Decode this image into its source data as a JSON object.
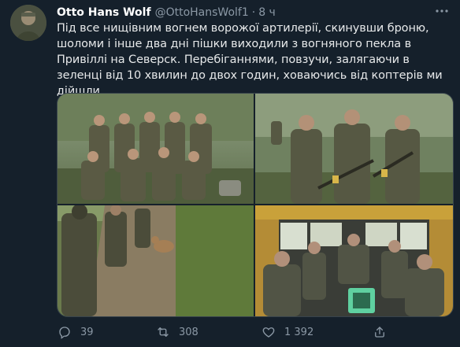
{
  "tweet": {
    "author_name": "Otto Hans Wolf",
    "author_handle": "@OttoHansWolf1",
    "separator": "·",
    "time": "8 ч",
    "text": "Під все нищівним вогнем ворожої артилерії, скинувши броню, шоломи і інше два дні пішки виходили з вогняного пекла в Привіллі на Северск. Перебіганнями, повзучи, залягаючи в зеленці від 10 хвилин до двох годин, ховаючись від коптерів ми дійшли.",
    "reply_count": "39",
    "retweet_count": "308",
    "like_count": "1 392"
  },
  "icons": {
    "more": "more-icon",
    "reply": "reply-icon",
    "retweet": "retweet-icon",
    "like": "heart-icon",
    "share": "share-icon"
  },
  "colors": {
    "background": "#15202b",
    "primary_text": "#e7e9ea",
    "secondary_text": "#8b98a5",
    "border": "#38444d"
  }
}
